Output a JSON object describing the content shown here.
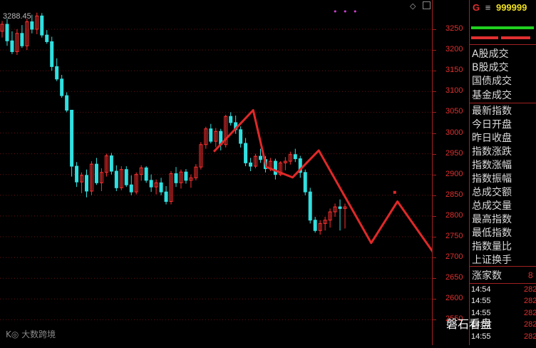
{
  "chart": {
    "high_label": "3288.45",
    "ticks": [
      "3250",
      "3200",
      "3150",
      "3100",
      "3050",
      "3000",
      "2950",
      "2900",
      "2850",
      "2800",
      "2750",
      "2700",
      "2650",
      "2600",
      "2550"
    ],
    "colors": {
      "up": "#ff3030",
      "down": "#30e0e0",
      "grid": "#6a1010",
      "pen": "#e02828",
      "axis": "#a02020"
    }
  },
  "panel": {
    "g_label": "G",
    "menu_icon": "≡",
    "code": "999999",
    "trade_labels": [
      "A股成交",
      "B股成交",
      "国债成交",
      "基金成交"
    ],
    "index_labels": [
      "最新指数",
      "今日开盘",
      "昨日收盘",
      "指数涨跌",
      "指数涨幅",
      "指数振幅",
      "总成交额",
      "总成交量",
      "最高指数",
      "最低指数",
      "指数量比",
      "上证换手"
    ],
    "zhangjia_label": "涨家数",
    "zhangjia_value": "8",
    "ticks": [
      {
        "time": "14:54",
        "value": "282"
      },
      {
        "time": "14:55",
        "value": "282"
      },
      {
        "time": "14:55",
        "value": "282"
      },
      {
        "time": "14:55",
        "value": "282"
      },
      {
        "time": "14:55",
        "value": "282"
      }
    ]
  },
  "branding": {
    "logo_text": "K◎ 大数跨境",
    "watermark": "磐石看盘"
  },
  "chart_data": {
    "type": "candlestick",
    "ylim": [
      2520,
      3310
    ],
    "candles": [
      [
        3245,
        3270,
        3230,
        3262
      ],
      [
        3262,
        3275,
        3210,
        3222
      ],
      [
        3222,
        3245,
        3190,
        3196
      ],
      [
        3196,
        3250,
        3188,
        3240
      ],
      [
        3240,
        3260,
        3205,
        3210
      ],
      [
        3210,
        3275,
        3200,
        3268
      ],
      [
        3268,
        3285,
        3240,
        3250
      ],
      [
        3250,
        3290,
        3238,
        3282
      ],
      [
        3282,
        3289,
        3230,
        3236
      ],
      [
        3236,
        3248,
        3215,
        3220
      ],
      [
        3220,
        3232,
        3150,
        3160
      ],
      [
        3160,
        3180,
        3125,
        3130
      ],
      [
        3130,
        3140,
        3085,
        3090
      ],
      [
        3090,
        3098,
        3050,
        3055
      ],
      [
        3055,
        2990,
        2895,
        2920
      ],
      [
        2920,
        2930,
        2870,
        2882
      ],
      [
        2882,
        2905,
        2855,
        2898
      ],
      [
        2898,
        2912,
        2845,
        2860
      ],
      [
        2860,
        2932,
        2850,
        2925
      ],
      [
        2925,
        2940,
        2875,
        2880
      ],
      [
        2880,
        2915,
        2860,
        2905
      ],
      [
        2905,
        2950,
        2895,
        2945
      ],
      [
        2945,
        2952,
        2900,
        2908
      ],
      [
        2908,
        2922,
        2860,
        2868
      ],
      [
        2868,
        2920,
        2862,
        2912
      ],
      [
        2912,
        2920,
        2870,
        2875
      ],
      [
        2875,
        2898,
        2850,
        2858
      ],
      [
        2858,
        2905,
        2852,
        2900
      ],
      [
        2900,
        2922,
        2885,
        2916
      ],
      [
        2916,
        2920,
        2880,
        2886
      ],
      [
        2886,
        2900,
        2858,
        2870
      ],
      [
        2870,
        2888,
        2852,
        2880
      ],
      [
        2880,
        2892,
        2850,
        2858
      ],
      [
        2858,
        2872,
        2828,
        2835
      ],
      [
        2835,
        2908,
        2828,
        2902
      ],
      [
        2902,
        2918,
        2870,
        2880
      ],
      [
        2880,
        2912,
        2866,
        2906
      ],
      [
        2906,
        2913,
        2878,
        2886
      ],
      [
        2886,
        2900,
        2868,
        2892
      ],
      [
        2892,
        2925,
        2886,
        2918
      ],
      [
        2918,
        2978,
        2912,
        2972
      ],
      [
        2972,
        3015,
        2962,
        3010
      ],
      [
        3010,
        3022,
        2975,
        2980
      ],
      [
        2980,
        3012,
        2966,
        3004
      ],
      [
        3004,
        3010,
        2958,
        2972
      ],
      [
        2972,
        3044,
        2965,
        3040
      ],
      [
        3040,
        3050,
        3018,
        3025
      ],
      [
        3025,
        3042,
        2998,
        3008
      ],
      [
        3008,
        3016,
        2965,
        2975
      ],
      [
        2975,
        2988,
        2920,
        2928
      ],
      [
        2928,
        2940,
        2908,
        2920
      ],
      [
        2920,
        2950,
        2915,
        2944
      ],
      [
        2944,
        2962,
        2928,
        2936
      ],
      [
        2936,
        2944,
        2905,
        2914
      ],
      [
        2914,
        2940,
        2908,
        2932
      ],
      [
        2932,
        2938,
        2888,
        2900
      ],
      [
        2900,
        2932,
        2896,
        2928
      ],
      [
        2928,
        2942,
        2910,
        2932
      ],
      [
        2932,
        2955,
        2924,
        2948
      ],
      [
        2948,
        2962,
        2930,
        2938
      ],
      [
        2938,
        2945,
        2892,
        2905
      ],
      [
        2905,
        2912,
        2850,
        2858
      ],
      [
        2858,
        2868,
        2782,
        2790
      ],
      [
        2790,
        2798,
        2760,
        2765
      ],
      [
        2765,
        2790,
        2755,
        2782
      ],
      [
        2782,
        2798,
        2765,
        2790
      ],
      [
        2790,
        2818,
        2772,
        2810
      ],
      [
        2810,
        2830,
        2798,
        2822
      ],
      [
        2822,
        2840,
        2765,
        2818
      ],
      [
        2818,
        2830,
        2770,
        2822
      ]
    ],
    "wave_line": [
      [
        0,
        2955
      ],
      [
        3,
        3055
      ],
      [
        4,
        2918
      ],
      [
        6,
        2893
      ],
      [
        8,
        2958
      ],
      [
        12,
        2735
      ],
      [
        14,
        2835
      ],
      [
        17,
        2700
      ],
      [
        20,
        3050
      ]
    ],
    "marker": [
      18,
      2857
    ]
  }
}
